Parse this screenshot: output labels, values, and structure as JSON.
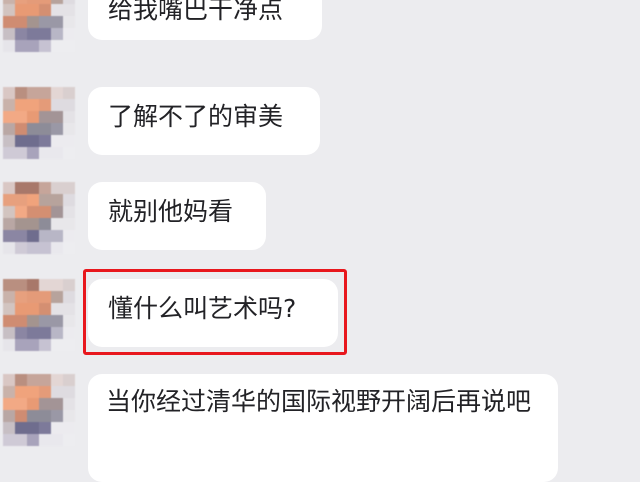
{
  "messages": [
    {
      "text": "给我嘴巴干净点",
      "highlighted": false
    },
    {
      "text": "了解不了的审美",
      "highlighted": false
    },
    {
      "text": "就别他妈看",
      "highlighted": false
    },
    {
      "text": "懂什么叫艺术吗?",
      "highlighted": true
    },
    {
      "text": "当你经过清华的国际视野开阔后再说吧",
      "highlighted": false
    }
  ],
  "colors": {
    "background": "#ececef",
    "bubble": "#ffffff",
    "text": "#222226",
    "highlight_border": "#e8171d"
  },
  "avatar_icon": "pixelated-avatar-icon"
}
